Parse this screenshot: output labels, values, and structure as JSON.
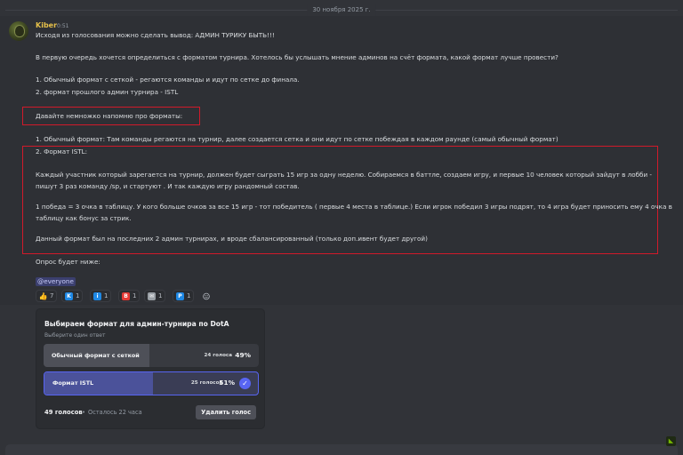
{
  "date_divider": "30 ноября 2025 г.",
  "message": {
    "author": "Kiber",
    "time": "0:51",
    "lines": {
      "l1": "Исходя из голосования можно сделать вывод: АДМИН ТУРИКУ БЫТЬ!!!",
      "l2": "В первую очередь хочется определиться с форматом турнира. Хотелось бы услышать мнение админов на счёт формата, какой формат лучше провести?",
      "l3": "1. Обычный формат с сеткой - регаются команды и идут по сетке до финала.",
      "l4": "2. формат прошлого админ турнира -  ISTL",
      "l5": "Давайте немножко напомню про форматы:",
      "l6": "1. Обычный формат: Там команды регаются на турнир, далее создается сетка и они идут по сетке побеждая в каждом раунде (самый обычный формат)",
      "l7": "2. Формат ISTL:",
      "l8": "Каждый участник который зарегается на турнир, должен будет сыграть 15 игр за одну неделю. Собираемся в баттле, создаем игру, и первые 10 человек который зайдут в лобби -",
      "l9": "пишут 3 раз команду /sp, и стартуют . И так каждую игру рандомный состав.",
      "l10": "1 победа = 3 очка в таблицу. У кого больше очков за все 15 игр - тот победитель ( первые 4 места в таблице.) Если игрок победил 3 игры подрят, то 4 игра будет приносить ему 4 очка в",
      "l11": "таблицу как бонус за стрик.",
      "l12": "Данный формат был на последних 2 админ турнирах, и вроде сбалансированный (только доп.ивент будет другой)",
      "l13": "Опрос будет ниже:"
    },
    "mention": "@everyone"
  },
  "reactions": [
    {
      "icon": "thumbs-up-icon",
      "label": "👍",
      "count": "7",
      "color": "#f5c542"
    },
    {
      "icon": "k-emoji-icon",
      "label": "K",
      "count": "1",
      "color": "#1e88e5"
    },
    {
      "icon": "info-emoji-icon",
      "label": "i",
      "count": "1",
      "color": "#1e88e5"
    },
    {
      "icon": "b-emoji-icon",
      "label": "B",
      "count": "1",
      "color": "#e53935"
    },
    {
      "icon": "envelope-emoji-icon",
      "label": "✉",
      "count": "1",
      "color": "#9aa0a6"
    },
    {
      "icon": "p-emoji-icon",
      "label": "P",
      "count": "1",
      "color": "#1e88e5"
    }
  ],
  "poll": {
    "question": "Выбираем формат для админ-турнира по DotA",
    "subtitle": "Выберите один ответ",
    "options": [
      {
        "label": "Обычный формат с сеткой",
        "votes": "24 голоса",
        "percent": "49%",
        "fraction": 0.49,
        "selected": false
      },
      {
        "label": "Формат ISTL",
        "votes": "25 голосов",
        "percent": "51%",
        "fraction": 0.51,
        "selected": true
      }
    ],
    "total_votes": "49 голосов",
    "separator": "•",
    "time_left": "Осталось 22 часа",
    "remove_vote_label": "Удалить голос"
  },
  "colors": {
    "highlight_box": "#d11a2a",
    "accent": "#5865f2",
    "author": "#e5c04a"
  }
}
